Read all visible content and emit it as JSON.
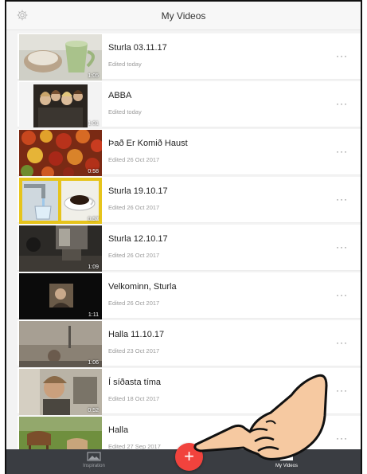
{
  "header": {
    "title": "My Videos",
    "settings_icon": "gear-icon"
  },
  "videos": [
    {
      "name": "Sturla 03.11.17",
      "edited": "Edited today",
      "duration": "1:05"
    },
    {
      "name": "ABBA",
      "edited": "Edited today",
      "duration": "1:01"
    },
    {
      "name": "Það Er Komið Haust",
      "edited": "Edited 26 Oct 2017",
      "duration": "0:58"
    },
    {
      "name": "Sturla 19.10.17",
      "edited": "Edited 26 Oct 2017",
      "duration": "0:57"
    },
    {
      "name": "Sturla 12.10.17",
      "edited": "Edited 26 Oct 2017",
      "duration": "1:09"
    },
    {
      "name": "Velkominn, Sturla",
      "edited": "Edited 26 Oct 2017",
      "duration": "1:11"
    },
    {
      "name": "Halla 11.10.17",
      "edited": "Edited 23 Oct 2017",
      "duration": "1:06"
    },
    {
      "name": "Í síðasta tíma",
      "edited": "Edited 18 Oct 2017",
      "duration": "0:52"
    },
    {
      "name": "Halla",
      "edited": "Edited 27 Sep 2017",
      "duration": ""
    }
  ],
  "more_label": "···",
  "tabbar": {
    "inspiration": {
      "label": "Inspiration",
      "icon": "image-icon"
    },
    "my_videos": {
      "label": "My Videos",
      "icon": "play-icon"
    }
  },
  "add_button": {
    "label": "+",
    "color": "#f1433d"
  }
}
